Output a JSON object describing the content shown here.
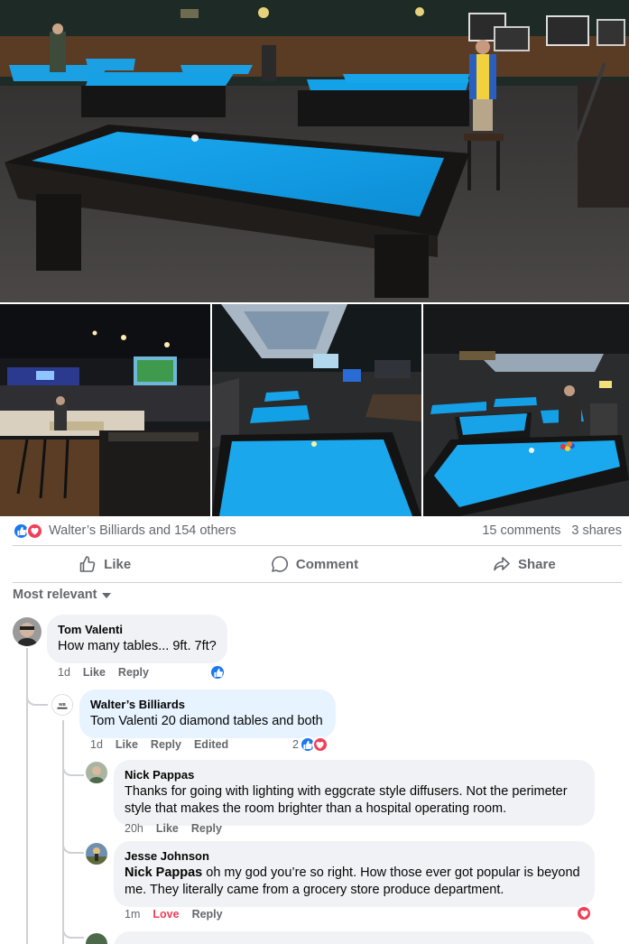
{
  "post": {
    "reactions_summary": "Walter’s Billiards and 154 others",
    "comments_count": "15 comments",
    "shares_count": "3 shares"
  },
  "actions": {
    "like": "Like",
    "comment": "Comment",
    "share": "Share"
  },
  "sort": {
    "label": "Most relevant"
  },
  "comments": [
    {
      "author": "Tom Valenti",
      "text": "How many tables... 9ft. 7ft?",
      "time": "1d",
      "like": "Like",
      "reply": "Reply",
      "reactions": [
        "like"
      ]
    },
    {
      "author": "Walter’s Billiards",
      "mention": "Tom Valenti",
      "text": " 20 diamond tables and both",
      "time": "1d",
      "like": "Like",
      "reply": "Reply",
      "edited": "Edited",
      "reaction_count": "2",
      "reactions": [
        "like",
        "love"
      ]
    },
    {
      "author": "Nick Pappas",
      "text": "Thanks for going with lighting with eggcrate style diffusers. Not the perimeter style that makes the room brighter than a hospital operating room.",
      "time": "20h",
      "like": "Like",
      "reply": "Reply"
    },
    {
      "author": "Jesse Johnson",
      "mention": "Nick Pappas",
      "text": " oh my god you’re so right. How those ever got popular is beyond me. They literally came from a grocery store produce department.",
      "time": "1m",
      "like": "Love",
      "reply": "Reply",
      "reactions": [
        "love"
      ]
    }
  ],
  "colors": {
    "felt": "#1aa3e8",
    "like_blue": "#1877f2",
    "love_red": "#f33e58",
    "muted": "#65676b"
  }
}
